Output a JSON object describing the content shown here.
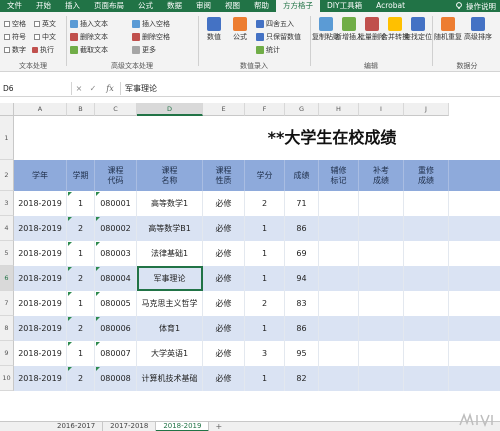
{
  "ribbon_tabs": [
    "文件",
    "开始",
    "插入",
    "页面布局",
    "公式",
    "数据",
    "审阅",
    "视图",
    "帮助",
    "方方格子",
    "DIY工具箱",
    "Acrobat"
  ],
  "active_tab_index": 9,
  "tell_me": "操作说明",
  "ribbon": {
    "text_group": {
      "label": "文本处理",
      "checks": [
        "空格",
        "英文",
        "符号",
        "中文",
        "数字"
      ],
      "run_label": "执行"
    },
    "adv_text_group": {
      "label": "高级文本处理",
      "items": [
        "插入文本",
        "删除文本",
        "截取文本",
        "插入空格",
        "删除空格",
        "更多"
      ]
    },
    "numeric_group": {
      "label": "数值录入",
      "items": [
        "四舍五入",
        "只保留数值",
        "数值",
        "公式",
        "统计"
      ]
    },
    "edit_group": {
      "label": "编辑",
      "buttons": [
        "复制粘贴",
        "新增插入",
        "批量删除",
        "合并转换",
        "查找定位"
      ]
    },
    "data_group": {
      "label": "数据分",
      "buttons": [
        "随机重复",
        "高级排序"
      ]
    }
  },
  "formula_bar": {
    "name_box": "D6",
    "cancel": "×",
    "enter": "✓",
    "fx": "fx",
    "content": "军事理论"
  },
  "columns": [
    "A",
    "B",
    "C",
    "D",
    "E",
    "F",
    "G",
    "H",
    "I",
    "J"
  ],
  "selected_column": "D",
  "rows": [
    "1",
    "2",
    "3",
    "4",
    "5",
    "6",
    "7",
    "8",
    "9",
    "10"
  ],
  "selected_row": "6",
  "sheet_title": "**大学生在校成绩",
  "table_headers": [
    "学年",
    "学期",
    "课程\n代码",
    "课程\n名称",
    "课程\n性质",
    "学分",
    "成绩",
    "辅修\n标记",
    "补考\n成绩",
    "重修\n成绩"
  ],
  "table_rows": [
    [
      "2018-2019",
      "1",
      "080001",
      "高等数学1",
      "必修",
      "2",
      "71",
      "",
      "",
      ""
    ],
    [
      "2018-2019",
      "2",
      "080002",
      "高等数学B1",
      "必修",
      "1",
      "86",
      "",
      "",
      ""
    ],
    [
      "2018-2019",
      "1",
      "080003",
      "法律基础1",
      "必修",
      "1",
      "69",
      "",
      "",
      ""
    ],
    [
      "2018-2019",
      "2",
      "080004",
      "军事理论",
      "必修",
      "1",
      "94",
      "",
      "",
      ""
    ],
    [
      "2018-2019",
      "1",
      "080005",
      "马克思主义哲学",
      "必修",
      "2",
      "83",
      "",
      "",
      ""
    ],
    [
      "2018-2019",
      "2",
      "080006",
      "体育1",
      "必修",
      "1",
      "86",
      "",
      "",
      ""
    ],
    [
      "2018-2019",
      "1",
      "080007",
      "大学英语1",
      "必修",
      "3",
      "95",
      "",
      "",
      ""
    ],
    [
      "2018-2019",
      "2",
      "080008",
      "计算机技术基础",
      "必修",
      "1",
      "82",
      "",
      "",
      ""
    ]
  ],
  "sheet_tabs": [
    "2016-2017",
    "2017-2018",
    "2018-2019"
  ],
  "active_sheet_index": 2,
  "add_sheet": "+",
  "colors": {
    "excel_green": "#217346",
    "header_fill": "#8eaadb",
    "band_fill": "#dae3f3"
  }
}
